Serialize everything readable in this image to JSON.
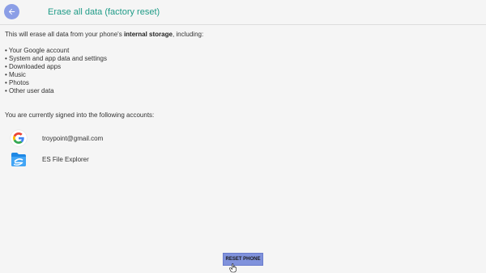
{
  "header": {
    "back_icon": "arrow-left-icon",
    "title": "Erase all data (factory reset)",
    "accent_color": "#1f9b87",
    "back_button_color": "#8b9ee6"
  },
  "intro": {
    "before": "This will erase all data from your phone's ",
    "bold": "internal storage",
    "after": ", including:"
  },
  "erase_items": [
    "• Your Google account",
    "• System and app data and settings",
    "• Downloaded apps",
    "• Music",
    "• Photos",
    "• Other user data"
  ],
  "signed_in_text": "You are currently signed into the following accounts:",
  "accounts": [
    {
      "icon": "google-icon",
      "label": "troypoint@gmail.com"
    },
    {
      "icon": "es-file-explorer-icon",
      "label": "ES File Explorer"
    }
  ],
  "reset_button": {
    "label": "RESET PHONE",
    "color": "#8092dc"
  },
  "pointer_icon": "hand-pointer-icon"
}
